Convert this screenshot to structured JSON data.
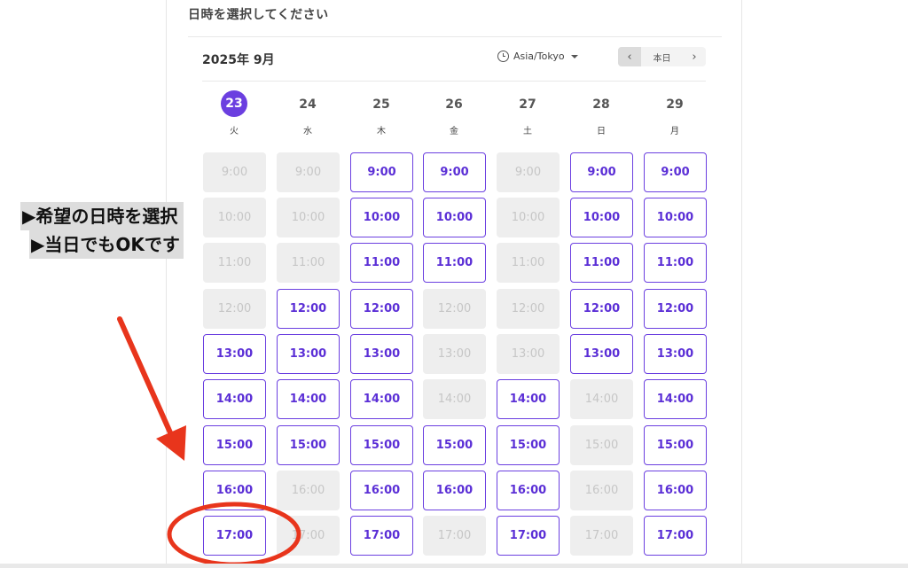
{
  "heading": "日時を選択してください",
  "calendar": {
    "month_label": "2025年 9月",
    "timezone": "Asia/Tokyo",
    "nav": {
      "prev": "‹",
      "today": "本日",
      "next": "›"
    },
    "accent_color": "#6b3fe0",
    "days": [
      {
        "num": "23",
        "weekday": "火",
        "selected": true
      },
      {
        "num": "24",
        "weekday": "水",
        "selected": false
      },
      {
        "num": "25",
        "weekday": "木",
        "selected": false
      },
      {
        "num": "26",
        "weekday": "金",
        "selected": false
      },
      {
        "num": "27",
        "weekday": "土",
        "selected": false
      },
      {
        "num": "28",
        "weekday": "日",
        "selected": false
      },
      {
        "num": "29",
        "weekday": "月",
        "selected": false
      }
    ],
    "times": [
      "9:00",
      "10:00",
      "11:00",
      "12:00",
      "13:00",
      "14:00",
      "15:00",
      "16:00",
      "17:00"
    ],
    "availability": [
      [
        false,
        false,
        false,
        false,
        true,
        true,
        true,
        true,
        true
      ],
      [
        false,
        false,
        false,
        true,
        true,
        true,
        true,
        false,
        false
      ],
      [
        true,
        true,
        true,
        true,
        true,
        true,
        true,
        true,
        true
      ],
      [
        true,
        true,
        true,
        false,
        false,
        false,
        true,
        true,
        false
      ],
      [
        false,
        false,
        false,
        false,
        false,
        true,
        true,
        true,
        true
      ],
      [
        true,
        true,
        true,
        true,
        true,
        false,
        false,
        false,
        false
      ],
      [
        true,
        true,
        true,
        true,
        true,
        true,
        true,
        true,
        true
      ]
    ]
  },
  "annotation": {
    "line1": "▶希望の日時を選択",
    "line2": "▶当日でもOKです",
    "arrow_color": "#e8351c",
    "circle_color": "#e8351c"
  }
}
